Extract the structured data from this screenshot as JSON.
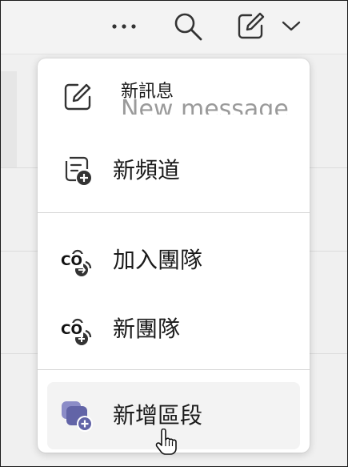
{
  "toolbar": {
    "more_icon": "more-horizontal-icon",
    "search_icon": "search-icon",
    "compose_icon": "compose-icon",
    "chevron_icon": "chevron-down-icon"
  },
  "menu": {
    "items": [
      {
        "label": "新訊息",
        "ghost_label": "New message",
        "icon": "compose-icon"
      },
      {
        "label": "新頻道",
        "icon": "channel-add-icon"
      },
      {
        "label": "加入團隊",
        "badge": "CO",
        "icon": "people-join-icon"
      },
      {
        "label": "新團隊",
        "badge": "CO",
        "icon": "people-add-icon"
      },
      {
        "label": "新增區段",
        "icon": "section-add-icon"
      }
    ]
  },
  "colors": {
    "accent": "#6264a7",
    "menu_bg": "#ffffff",
    "highlight": "#f3f3f3"
  }
}
